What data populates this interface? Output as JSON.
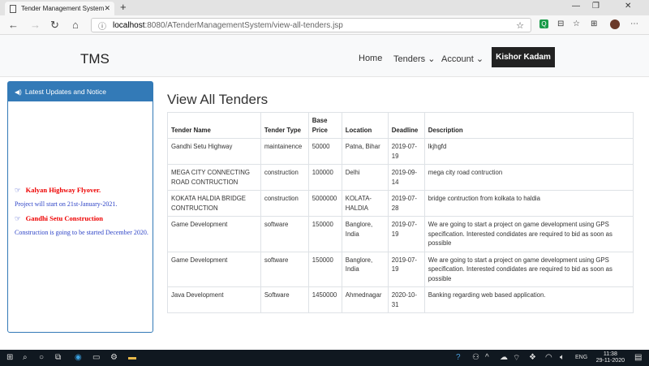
{
  "browser": {
    "tab_title": "Tender Management System",
    "url_host": "localhost",
    "url_rest": ":8080/ATenderManagementSystem/view-all-tenders.jsp"
  },
  "navbar": {
    "brand": "TMS",
    "home": "Home",
    "tenders": "Tenders",
    "account": "Account",
    "user": "Kishor Kadam"
  },
  "notice": {
    "header": "Latest Updates and Notice",
    "items": [
      {
        "title": "Kalyan Highway Flyover.",
        "text": "Project will start on 21st-January-2021."
      },
      {
        "title": "Gandhi Setu Construction",
        "text": "Construction is going to be started December 2020."
      }
    ]
  },
  "main": {
    "title": "View All Tenders",
    "columns": [
      "Tender Name",
      "Tender Type",
      "Base Price",
      "Location",
      "Deadline",
      "Description"
    ],
    "rows": [
      [
        "Gandhi Setu Highway",
        "maintainence",
        "50000",
        "Patna, Bihar",
        "2019-07-19",
        "lkjhgfd"
      ],
      [
        "MEGA CITY CONNECTING ROAD CONTRUCTION",
        "construction",
        "100000",
        "Delhi",
        "2019-09-14",
        "mega city road contruction"
      ],
      [
        "KOKATA HALDIA BRIDGE CONTRUCTION",
        "construction",
        "5000000",
        "KOLATA-HALDIA",
        "2019-07-28",
        "bridge contruction from kolkata to haldia"
      ],
      [
        "Game Development",
        "software",
        "150000",
        "Banglore, India",
        "2019-07-19",
        "We are going to start a project on game development using GPS specification. Interested condidates are required to bid as soon as possible"
      ],
      [
        "Game Development",
        "software",
        "150000",
        "Banglore, India",
        "2019-07-19",
        "We are going to start a project on game development using GPS specification. Interested condidates are required to bid as soon as possible"
      ],
      [
        "Java Development",
        "Software",
        "1450000",
        "Ahmednagar",
        "2020-10-31",
        "Banking regarding web based application."
      ]
    ]
  },
  "taskbar": {
    "lang": "ENG",
    "time": "11:38",
    "date": "29-11-2020"
  }
}
